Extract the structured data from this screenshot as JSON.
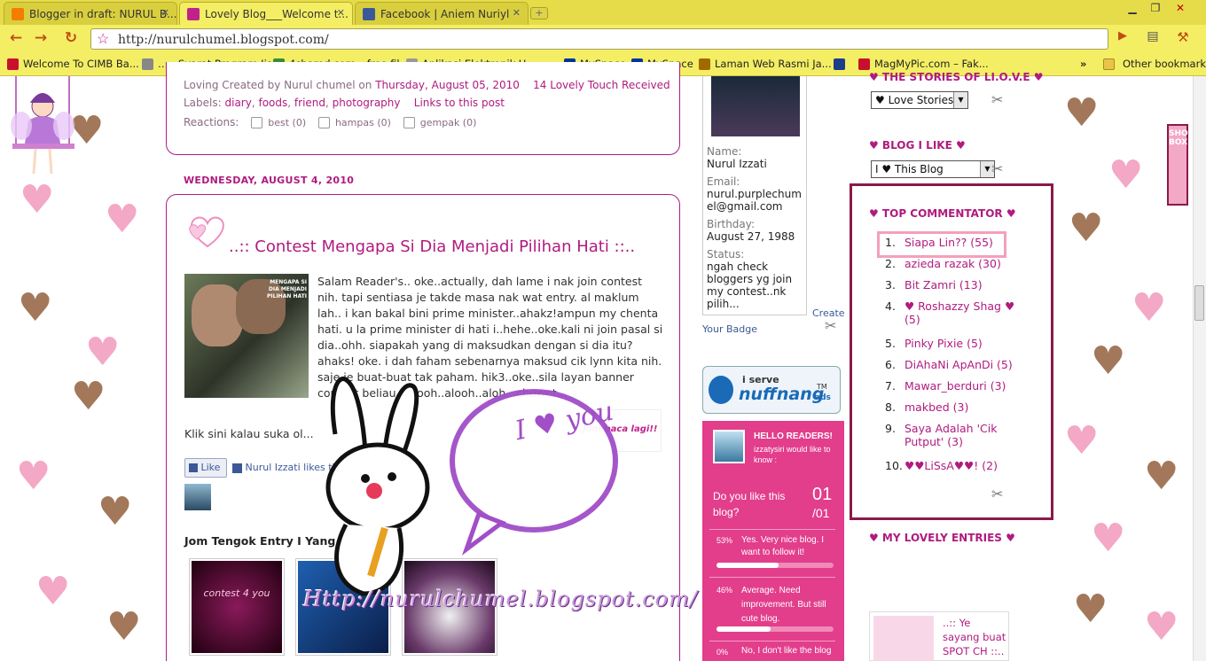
{
  "browser": {
    "tabs": [
      {
        "label": "Blogger in draft: NURUL B...",
        "active": false
      },
      {
        "label": "Lovely Blog___Welcome t...",
        "active": true
      },
      {
        "label": "Facebook | Aniem Nuriyl",
        "active": false
      }
    ],
    "address": "http://nurulchumel.blogspot.com/",
    "bookmarks": [
      "Welcome To CIMB Ba...",
      "…:: Syarat Program Ija...",
      "4shared.com – free fil...",
      "Aplikasi Elektronik U...",
      "MySpace",
      "MySpace",
      "Laman Web Rasmi Ja...",
      "MagMyPic.com – Fak...",
      "Other bookmarks"
    ],
    "bookmark_overflow": "»"
  },
  "prev_post": {
    "footer_prefix": "Loving Created by Nurul chumel on",
    "footer_date": "Thursday, August 05, 2010",
    "footer_comments": "14 Lovely Touch Received",
    "labels_prefix": "Labels:",
    "labels": [
      "diary",
      "foods",
      "friend",
      "photography"
    ],
    "links_to_post": "Links to this post",
    "reactions_label": "Reactions:",
    "reactions": [
      "best (0)",
      "hampas (0)",
      "gempak (0)"
    ]
  },
  "post": {
    "date_header": "WEDNESDAY, AUGUST 4, 2010",
    "title": "..:: Contest Mengapa Si Dia Menjadi Pilihan Hati ::..",
    "image_caption": "MENGAPA SI DIA MENJADI PILIHAN HATI",
    "body": "Salam Reader's.. oke..actually, dah lame i nak join contest nih. tapi sentiasa je takde masa nak wat entry. al maklum lah.. i kan bakal bini prime minister..ahakz!ampun my chenta hati. u la prime minister di hati i..hehe..oke.kali ni join pasal si dia..ohh. siapakah yang di maksudkan dengan si dia itu? ahaks! oke. i dah faham sebenarnya maksud cik lynn kita nih. saje je buat-buat tak paham. hik3..oke..sila layan banner contest beliau..hoooh..alooh..aloh...chuwet...",
    "click_here": "Klik sini kalau suka ol...",
    "like_button": "Like",
    "like_text": "Nurul Izzati likes thi...",
    "banner_text": "Jom baca lagi!!",
    "related_heading": "Jom Tengok Entry I Yang Lain...",
    "related_items": [
      "contest 4 you",
      "",
      ""
    ]
  },
  "overlay": {
    "speech": "I ♥ you",
    "url_text": "Http://nurulchumel.blogspot.com/"
  },
  "profile": {
    "name_label": "Name:",
    "name": "Nurul Izzati",
    "email_label": "Email:",
    "email": "nurul.purplechumel@gmail.com",
    "birthday_label": "Birthday:",
    "birthday": "August 27, 1988",
    "status_label": "Status:",
    "status": "ngah check bloggers yg join my contest..nk pilih...",
    "create_link": "Create",
    "badge_link": "Your Badge"
  },
  "nuffnang": {
    "line1": "i serve",
    "brand": "nuffnang",
    "tm": "TM",
    "suffix": "ads"
  },
  "poll": {
    "header": "HELLO READERS!",
    "sub": "izzatysiri would like to know :",
    "question": "Do you like this blog?",
    "counter": "01",
    "counter_total": "/01",
    "options": [
      {
        "pct": "53%",
        "text": "Yes. Very nice blog. I want to follow it!",
        "fill": 0.53
      },
      {
        "pct": "46%",
        "text": "Average. Need improvement. But still cute blog.",
        "fill": 0.46
      },
      {
        "pct": "0%",
        "text": "No, I don't like the blog",
        "fill": 0
      }
    ]
  },
  "right": {
    "stories_title": "♥ THE STORIES OF LI.O.V.E ♥",
    "stories_select": "♥ Love Stories",
    "blog_title": "♥ BLOG I LIKE ♥",
    "blog_select": "I ♥ This Blog",
    "top_title": "♥ TOP COMMENTATOR ♥",
    "top_list": [
      {
        "n": "1.",
        "name": "Siapa Lin?? (55)"
      },
      {
        "n": "2.",
        "name": "azieda razak (30)"
      },
      {
        "n": "3.",
        "name": "Bit Zamri (13)"
      },
      {
        "n": "4.",
        "name": "♥ Roshazzy Shag ♥ (5)"
      },
      {
        "n": "5.",
        "name": "Pinky Pixie (5)"
      },
      {
        "n": "6.",
        "name": "DiAhaNi ApAnDi (5)"
      },
      {
        "n": "7.",
        "name": "Mawar_berduri (3)"
      },
      {
        "n": "8.",
        "name": "makbed (3)"
      },
      {
        "n": "9.",
        "name": "Saya Adalah 'Cik Putput' (3)"
      },
      {
        "n": "10.",
        "name": "♥♥LiSsA♥♥! (2)"
      }
    ],
    "entries_title": "♥ MY LOVELY ENTRIES ♥",
    "entry_preview": "..:: Ye sayang buat SPOT CH ::.."
  },
  "shoutbox": "SHOUT BOX",
  "colors": {
    "accent": "#b01b7f",
    "chrome": "#f4ee64",
    "poll": "#e23e8c",
    "frame": "#8a1a4a"
  }
}
